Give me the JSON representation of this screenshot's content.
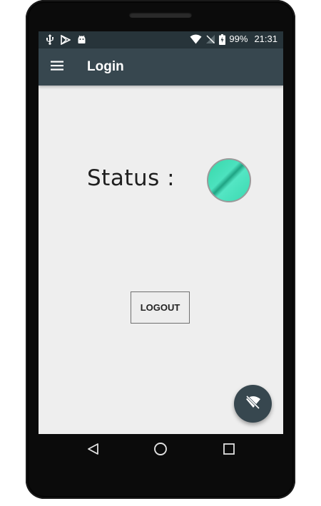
{
  "status_bar": {
    "battery": "99%",
    "time": "21:31",
    "left_icons": [
      "usb-icon",
      "play-store-icon",
      "android-icon"
    ],
    "right_icons": [
      "wifi-icon",
      "no-signal-icon",
      "battery-charging-icon"
    ]
  },
  "app_bar": {
    "title": "Login",
    "menu_icon": "hamburger-menu-icon",
    "color": "#37474f"
  },
  "main": {
    "status_label": "Status :",
    "status_indicator_color": "#3ad9b0",
    "logout_label": "LOGOUT"
  },
  "fab": {
    "icon": "wifi-off-icon",
    "color": "#37474f"
  },
  "nav": {
    "back_icon": "back-triangle-icon",
    "home_icon": "home-circle-icon",
    "recents_icon": "recents-square-icon"
  },
  "colors": {
    "status_bar": "#27343a",
    "background": "#eeeeee"
  }
}
